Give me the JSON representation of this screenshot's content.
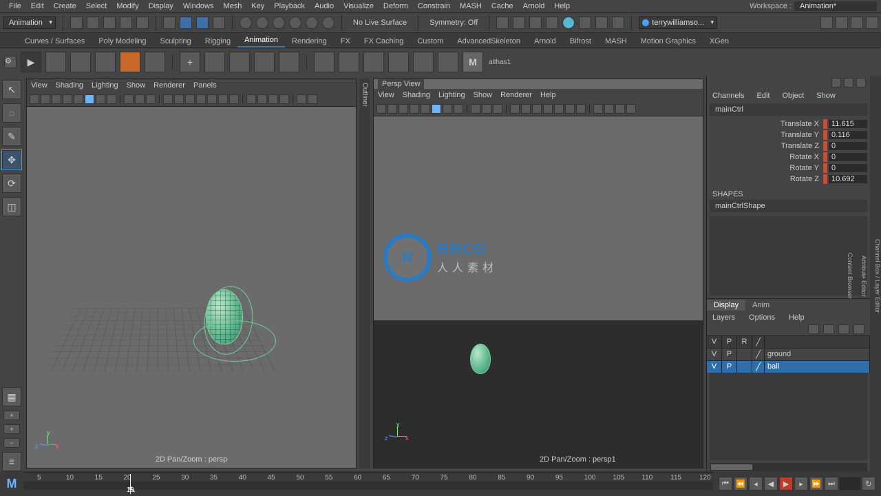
{
  "menubar": [
    "File",
    "Edit",
    "Create",
    "Select",
    "Modify",
    "Display",
    "Windows",
    "Mesh",
    "Key",
    "Playback",
    "Audio",
    "Visualize",
    "Deform",
    "Constrain",
    "MASH",
    "Cache",
    "Arnold",
    "Help"
  ],
  "workspace": {
    "label": "Workspace :",
    "value": "Animation*"
  },
  "mode_dropdown": "Animation",
  "status_text": {
    "live": "No Live Surface",
    "symmetry": "Symmetry: Off"
  },
  "user": "terrywilliamso...",
  "shelf_tabs": [
    "Curves / Surfaces",
    "Poly Modeling",
    "Sculpting",
    "Rigging",
    "Animation",
    "Rendering",
    "FX",
    "FX Caching",
    "Custom",
    "AdvancedSkeleton",
    "Arnold",
    "Bifrost",
    "MASH",
    "Motion Graphics",
    "XGen"
  ],
  "shelf_active": "Animation",
  "shelf_extra_label": "althas1",
  "viewport_left": {
    "menu": [
      "View",
      "Shading",
      "Lighting",
      "Show",
      "Renderer",
      "Panels"
    ],
    "status": "2D Pan/Zoom : persp"
  },
  "viewport_right": {
    "title": "Persp View",
    "menu": [
      "View",
      "Shading",
      "Lighting",
      "Show",
      "Renderer",
      "Help"
    ],
    "status": "2D Pan/Zoom : persp1"
  },
  "outliner_label": "Outliner",
  "channel_box": {
    "menu": [
      "Channels",
      "Edit",
      "Object",
      "Show"
    ],
    "object": "mainCtrl",
    "attrs": [
      {
        "label": "Translate X",
        "value": "11.615"
      },
      {
        "label": "Translate Y",
        "value": "0.116"
      },
      {
        "label": "Translate Z",
        "value": "0"
      },
      {
        "label": "Rotate X",
        "value": "0"
      },
      {
        "label": "Rotate Y",
        "value": "0"
      },
      {
        "label": "Rotate Z",
        "value": "10.692"
      }
    ],
    "shapes_label": "SHAPES",
    "shape_name": "mainCtrlShape"
  },
  "layer_tabs": {
    "display": "Display",
    "anim": "Anim"
  },
  "layer_menu": [
    "Layers",
    "Options",
    "Help"
  ],
  "layer_header": {
    "v": "V",
    "p": "P",
    "r": "R"
  },
  "layer_rows": [
    {
      "v": "V",
      "p": "P",
      "name": "ground",
      "selected": false
    },
    {
      "v": "V",
      "p": "P",
      "name": "ball",
      "selected": true
    }
  ],
  "side_tabs": [
    "Channel Box / Layer Editor",
    "Attribute Editor",
    "Content Browser"
  ],
  "timeline": {
    "ticks": [
      5,
      10,
      15,
      20,
      25,
      30,
      35,
      40,
      45,
      50,
      55,
      60,
      65,
      70,
      75,
      80,
      85,
      90,
      95,
      100,
      105,
      110,
      115,
      120
    ],
    "cursor_label": "19"
  },
  "watermark": {
    "brand": "RRCG",
    "sub": "人人素材"
  }
}
